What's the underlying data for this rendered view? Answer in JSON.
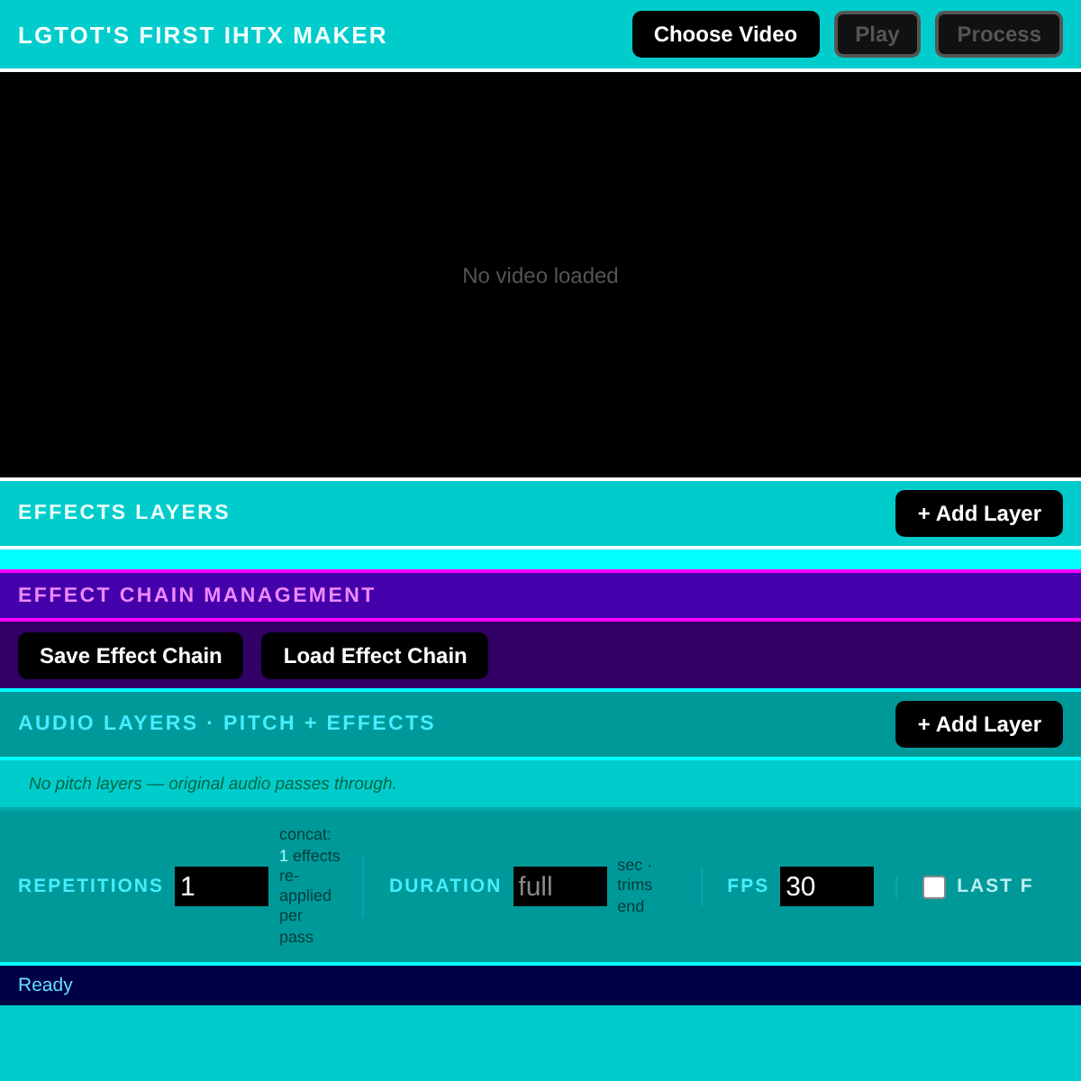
{
  "header": {
    "title": "LGTOT'S FIRST IHTX MAKER",
    "buttons": [
      {
        "label": "Choose Video",
        "disabled": false
      },
      {
        "label": "Play",
        "disabled": true
      },
      {
        "label": "Process",
        "disabled": true
      }
    ]
  },
  "video": {
    "message": "No video loaded"
  },
  "effects_layers": {
    "title": "EFFECTS LAYERS",
    "button": "+ Add Layer"
  },
  "effect_chain": {
    "title": "EFFECT CHAIN MANAGEMENT",
    "buttons": [
      "Save Effect Chain",
      "Load Effect Chain"
    ]
  },
  "audio_layers": {
    "title": "AUDIO LAYERS · PITCH + EFFECTS",
    "button": "+ Add Layer",
    "note": "No pitch layers — original audio passes through."
  },
  "settings": [
    {
      "kind": "number",
      "label": "REPETITIONS",
      "value": "1",
      "hint": [
        "concat:",
        "1",
        "effects re-applied per pass"
      ]
    },
    {
      "kind": "number",
      "label": "DURATION",
      "placeholder": "full",
      "hint": [
        "sec · trims end"
      ]
    },
    {
      "kind": "number",
      "label": "FPS",
      "value": "30"
    },
    {
      "kind": "checkbox",
      "label": "LAST F",
      "checked": false
    }
  ],
  "status_bar": {
    "text": "Ready"
  }
}
